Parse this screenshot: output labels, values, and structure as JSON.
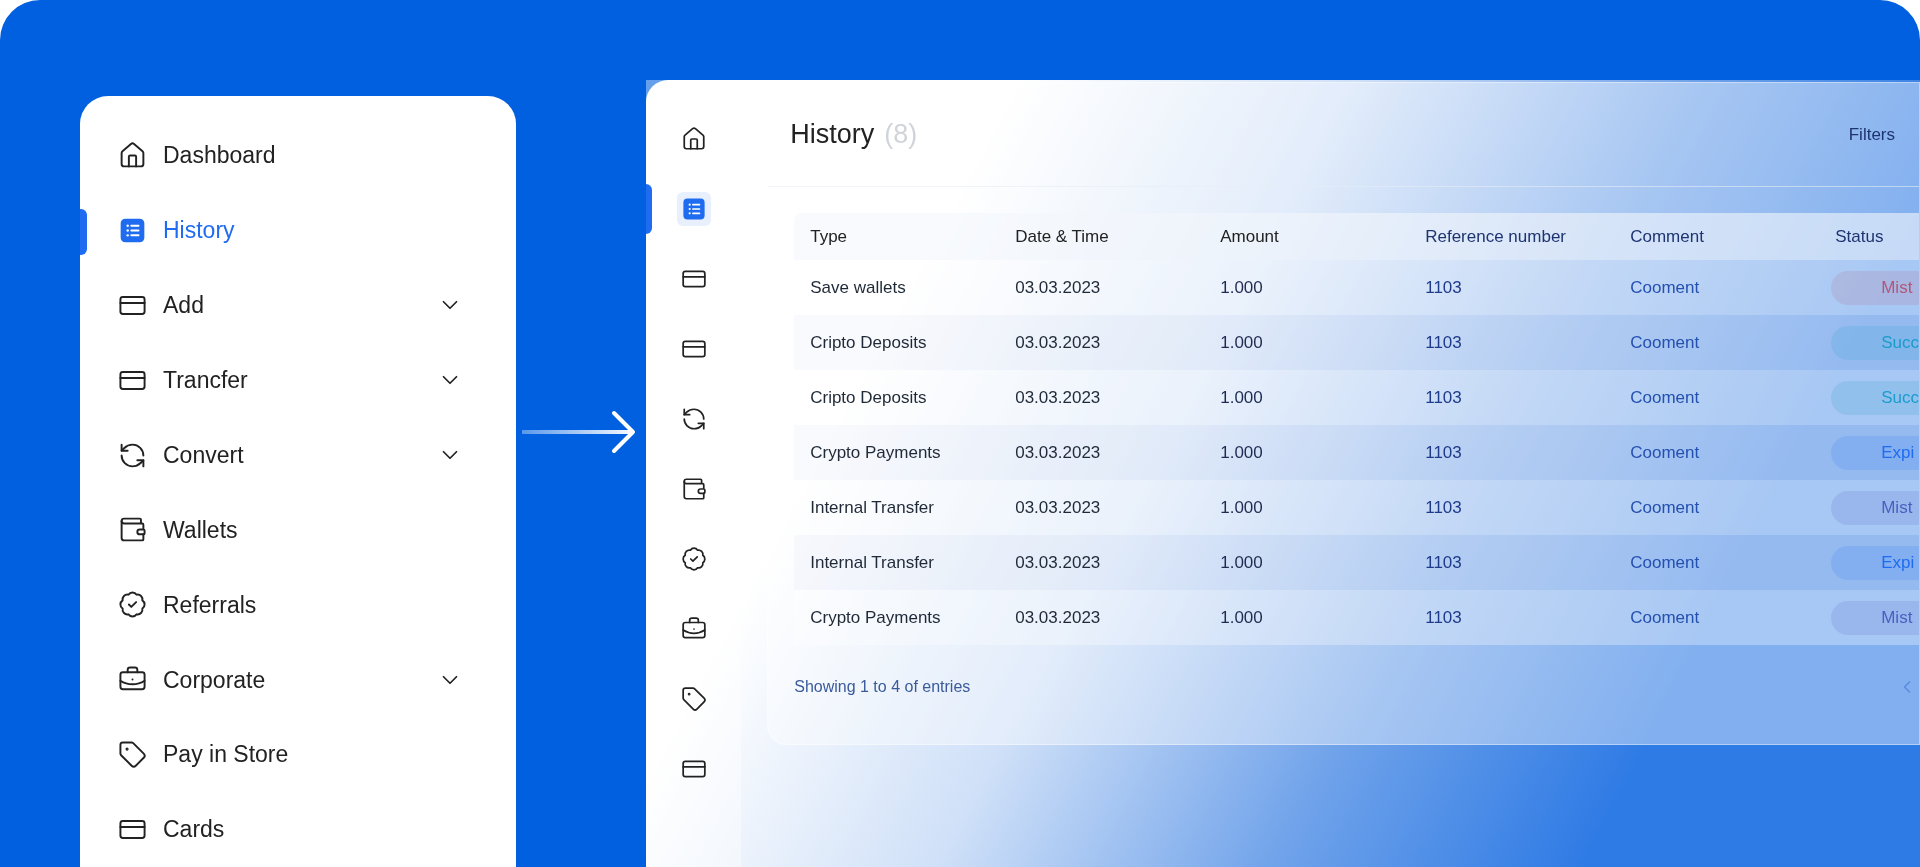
{
  "sidebar": {
    "items": [
      {
        "label": "Dashboard",
        "selected": false,
        "expandable": false
      },
      {
        "label": "History",
        "selected": true,
        "expandable": false
      },
      {
        "label": "Add",
        "selected": false,
        "expandable": true
      },
      {
        "label": "Trancfer",
        "selected": false,
        "expandable": true
      },
      {
        "label": "Convert",
        "selected": false,
        "expandable": true
      },
      {
        "label": "Wallets",
        "selected": false,
        "expandable": false
      },
      {
        "label": "Referrals",
        "selected": false,
        "expandable": false
      },
      {
        "label": "Corporate",
        "selected": false,
        "expandable": true
      },
      {
        "label": "Pay in Store",
        "selected": false,
        "expandable": false
      },
      {
        "label": "Cards",
        "selected": false,
        "expandable": false
      }
    ]
  },
  "rail": [
    {
      "selected": false
    },
    {
      "selected": true
    },
    {
      "selected": false
    },
    {
      "selected": false
    },
    {
      "selected": false
    },
    {
      "selected": false
    },
    {
      "selected": false
    },
    {
      "selected": false
    },
    {
      "selected": false
    },
    {
      "selected": false
    }
  ],
  "history": {
    "title": "History",
    "count": "(8)",
    "filters": "Filters",
    "table": {
      "columns": [
        "Type",
        "Date & Time",
        "Amount",
        "Reference number",
        "Comment",
        "Status"
      ],
      "rows": [
        {
          "cells": [
            "Save wallets",
            "03.03.2023",
            "1.000",
            "1103",
            "Cooment"
          ],
          "status": {
            "label": "Mist",
            "color": "#b0587a"
          }
        },
        {
          "cells": [
            "Cripto Deposits",
            "03.03.2023",
            "1.000",
            "1103",
            "Cooment"
          ],
          "status": {
            "label": "Succ",
            "color": "#1a9ccc"
          }
        },
        {
          "cells": [
            "Cripto Deposits",
            "03.03.2023",
            "1.000",
            "1103",
            "Cooment"
          ],
          "status": {
            "label": "Succ",
            "color": "#1a9ccc"
          }
        },
        {
          "cells": [
            "Crypto Payments",
            "03.03.2023",
            "1.000",
            "1103",
            "Cooment"
          ],
          "status": {
            "label": "Expi",
            "color": "#1f6cf0"
          }
        },
        {
          "cells": [
            "Internal Transfer",
            "03.03.2023",
            "1.000",
            "1103",
            "Cooment"
          ],
          "status": {
            "label": "Mist",
            "color": "#4a5fc0"
          }
        },
        {
          "cells": [
            "Internal Transfer",
            "03.03.2023",
            "1.000",
            "1103",
            "Cooment"
          ],
          "status": {
            "label": "Expi",
            "color": "#1f6cf0"
          }
        },
        {
          "cells": [
            "Crypto Payments",
            "03.03.2023",
            "1.000",
            "1103",
            "Cooment"
          ],
          "status": {
            "label": "Mist",
            "color": "#4a5fc0"
          }
        }
      ]
    },
    "footer": "Showing 1 to 4 of entries"
  }
}
